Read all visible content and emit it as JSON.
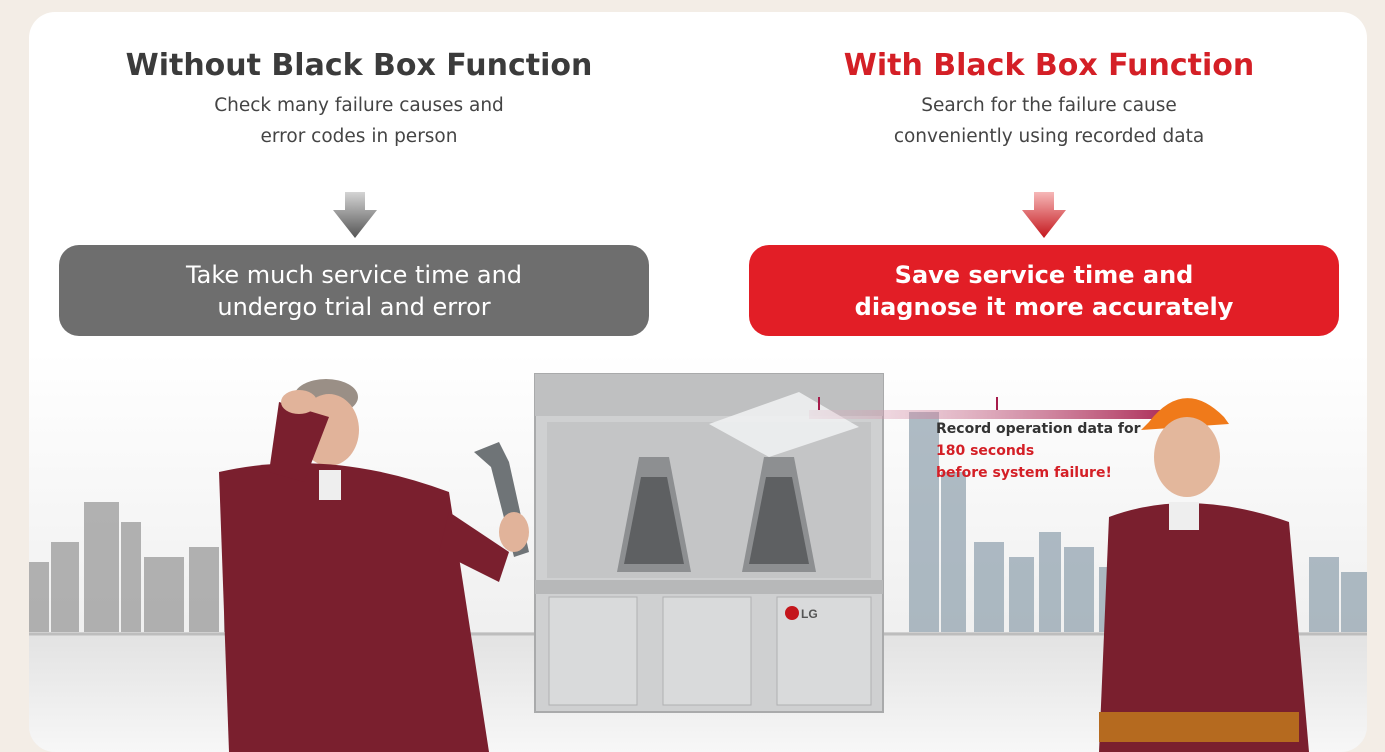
{
  "left": {
    "title": "Without Black Box Function",
    "subtitle": "Check many failure causes and\nerror codes in person",
    "result": "Take much service time and\nundergo trial and error"
  },
  "right": {
    "title": "With Black Box Function",
    "subtitle": "Search for the failure cause\nconveniently using recorded data",
    "result": "Save service time and\ndiagnose it more accurately"
  },
  "callout": {
    "line1": "Record operation data for",
    "line2": "180 seconds",
    "line3": "before system failure!"
  },
  "unit_brand": "LG",
  "colors": {
    "accent_red": "#e21e26",
    "title_red": "#d41f26",
    "grey_pill": "#6e6e6e",
    "page_bg": "#f3ede6",
    "uniform": "#7a1f2e"
  },
  "icons": {
    "left_arrow": "down-arrow-icon",
    "right_arrow": "down-arrow-icon",
    "brand": "lg-logo"
  }
}
